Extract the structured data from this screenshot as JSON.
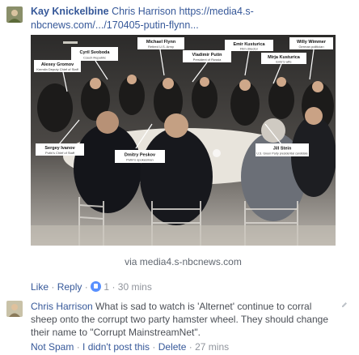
{
  "comment1": {
    "author": "Kay Knickelbine",
    "mention": "Chris Harrison",
    "link_text": "https://media4.s-nbcnews.com/.../170405-putin-flynn..."
  },
  "preview": {
    "labels": [
      {
        "name": "Cyril Svoboda",
        "title": "Czech Republic"
      },
      {
        "name": "Michael Flynn",
        "title": "Retired U.S. Army"
      },
      {
        "name": "Vladimir Putin",
        "title": "President of Russia"
      },
      {
        "name": "Emir Kusturica",
        "title": "Film director"
      },
      {
        "name": "Willy Wimmer",
        "title": "German politician"
      },
      {
        "name": "Alexey Gromov",
        "title": "Kremlin Deputy Chief of Staff"
      },
      {
        "name": "Mirja Kusturica",
        "title": "Emir's wife"
      },
      {
        "name": "Sergey Ivanov",
        "title": "Putin's Chief of Staff"
      },
      {
        "name": "Dmitry Peskov",
        "title": "Putin's spokesman"
      },
      {
        "name": "Jill Stein",
        "title": "U.S. Green Party presidential candidate"
      }
    ],
    "via": "via media4.s-nbcnews.com"
  },
  "actions": {
    "like": "Like",
    "reply": "Reply",
    "like_count": "1",
    "time": "30 mins"
  },
  "comment2": {
    "author": "Chris Harrison",
    "body": "What is sad to watch is 'Alternet' continue to corral sheep onto the corrupt two party hamster wheel. They should change their name to \"Corrupt MainstreamNet\".",
    "not_spam": "Not Spam",
    "didnt_post": "I didn't post this",
    "delete": "Delete",
    "time": "27 mins"
  },
  "colors": {
    "link": "#365899",
    "meta": "#90949c",
    "like_badge": "#5890ff"
  }
}
